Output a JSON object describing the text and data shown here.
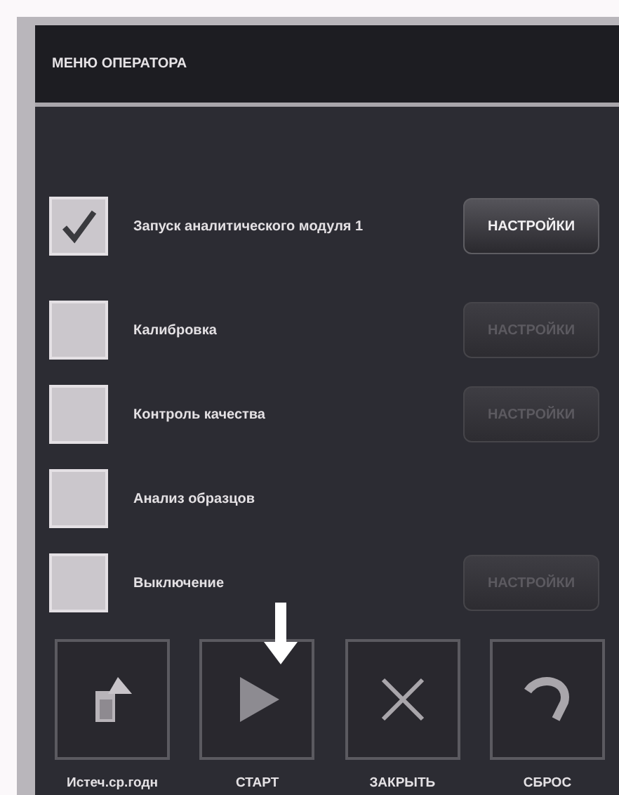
{
  "window": {
    "title": "МЕНЮ ОПЕРАТОРА"
  },
  "items": [
    {
      "label": "Запуск аналитического модуля 1",
      "checked": true,
      "settings": {
        "label": "НАСТРОЙКИ",
        "disabled": false
      }
    },
    {
      "label": "Калибровка",
      "checked": false,
      "settings": {
        "label": "НАСТРОЙКИ",
        "disabled": true
      }
    },
    {
      "label": "Контроль качества",
      "checked": false,
      "settings": {
        "label": "НАСТРОЙКИ",
        "disabled": true
      }
    },
    {
      "label": "Анализ образцов",
      "checked": false
    },
    {
      "label": "Выключение",
      "checked": false,
      "settings": {
        "label": "НАСТРОЙКИ",
        "disabled": true
      }
    }
  ],
  "actions": [
    {
      "label": "Истеч.ср.годн",
      "kind": "expiry",
      "pointed": false
    },
    {
      "label": "СТАРТ",
      "kind": "play",
      "pointed": true
    },
    {
      "label": "ЗАКРЫТЬ",
      "kind": "close",
      "pointed": false
    },
    {
      "label": "СБРОС",
      "kind": "undo",
      "pointed": false
    }
  ]
}
